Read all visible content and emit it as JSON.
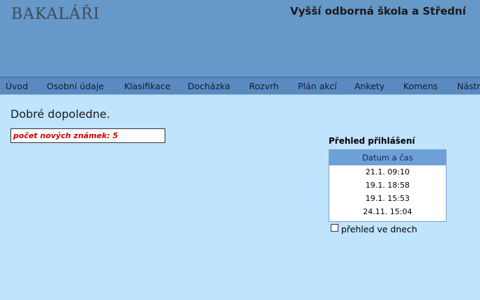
{
  "app": {
    "logo": "BAKALÁŘI"
  },
  "header": {
    "school_name": "Vyšší odborná škola a Střední"
  },
  "nav": {
    "items": [
      {
        "label": "Úvod"
      },
      {
        "label": "Osobní údaje"
      },
      {
        "label": "Klasifikace"
      },
      {
        "label": "Docházka"
      },
      {
        "label": "Rozvrh"
      },
      {
        "label": "Plán akcí"
      },
      {
        "label": "Ankety"
      },
      {
        "label": "Komens"
      },
      {
        "label": "Nástr"
      }
    ]
  },
  "main": {
    "greeting": "Dobré dopoledne.",
    "new_grades": "počet nových známek: 5"
  },
  "login_overview": {
    "title": "Přehled přihlášení",
    "column_header": "Datum a čas",
    "rows": [
      "21.1. 09:10",
      "19.1. 18:58",
      "19.1. 15:53",
      "24.11. 15:04"
    ],
    "checkbox_label": "přehled ve dnech",
    "checkbox_checked": false
  },
  "colors": {
    "page_background": "#c0e3fe",
    "header_background": "#6698c8",
    "nav_background": "#5b8ac0",
    "grade_alert_text": "#d40000"
  }
}
